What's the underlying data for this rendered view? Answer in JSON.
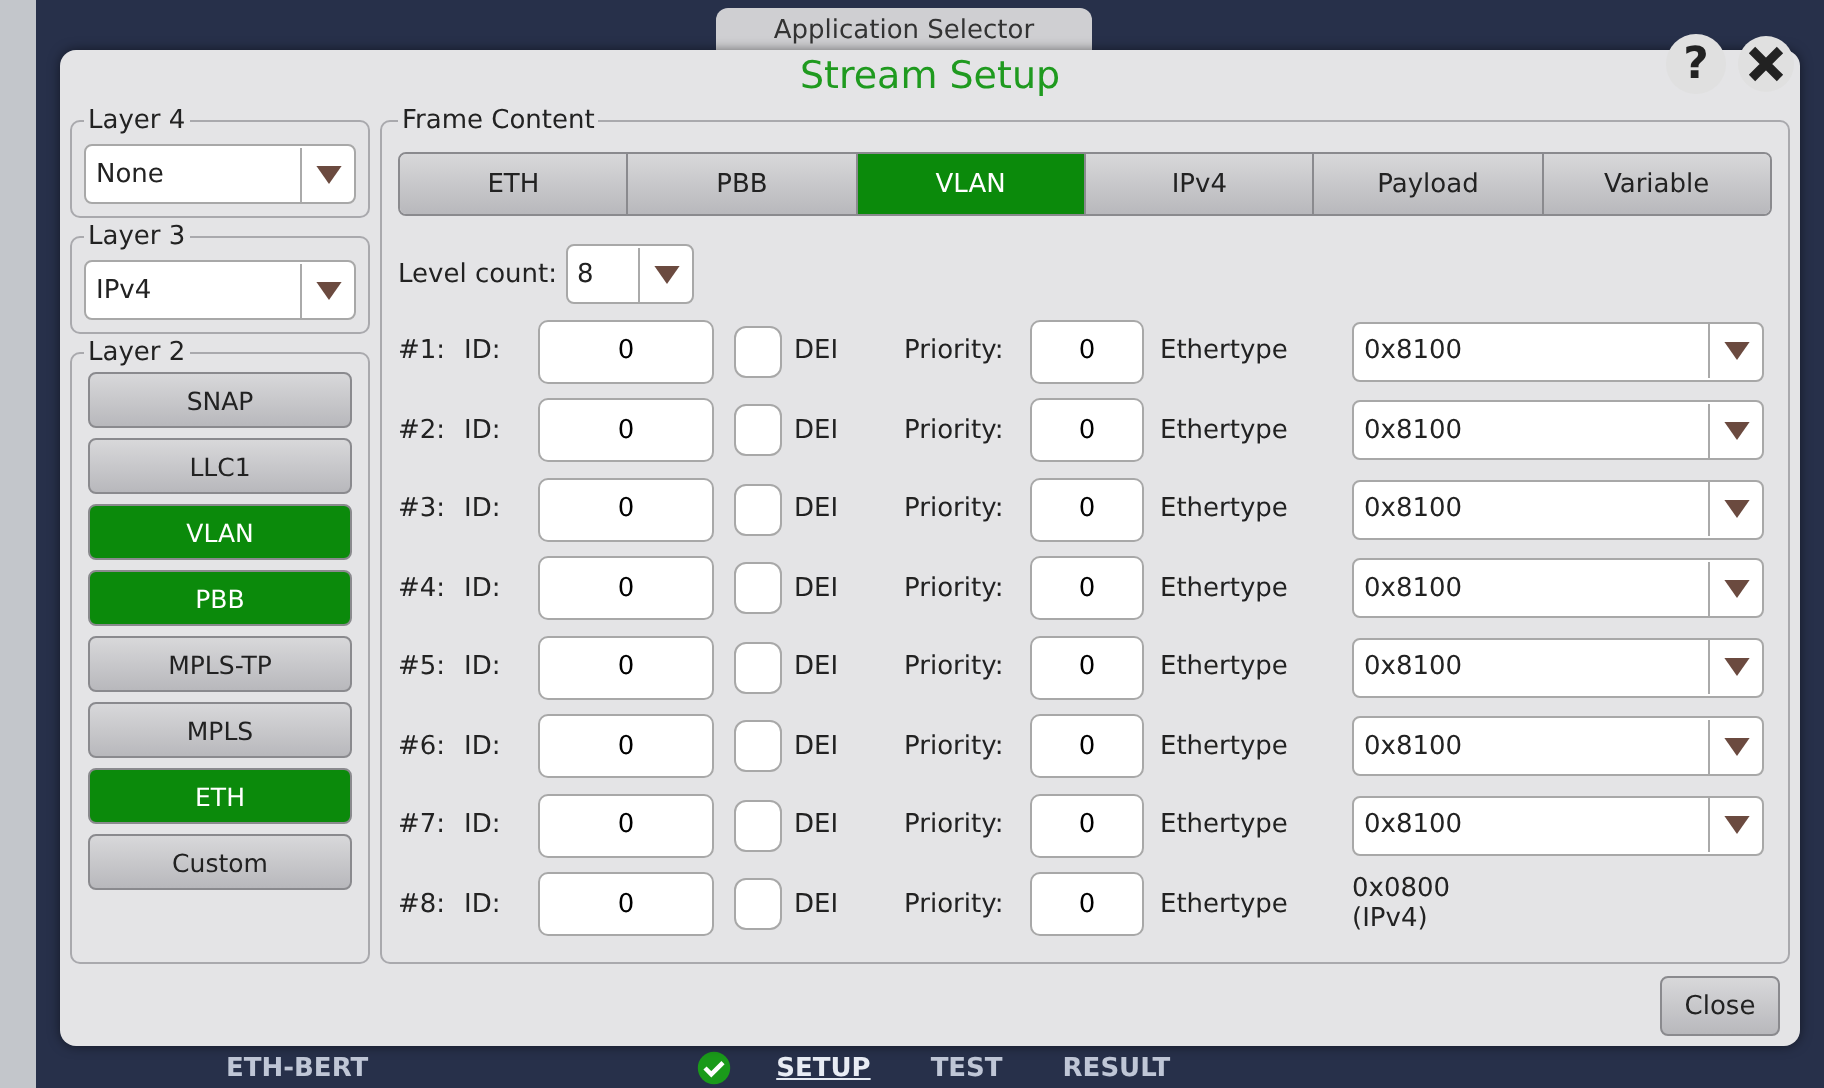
{
  "background_app": {
    "tab": "Application Selector",
    "app_name": "ETH-BERT",
    "nav": [
      {
        "label": "SETUP",
        "selected": true
      },
      {
        "label": "TEST",
        "selected": false
      },
      {
        "label": "RESULT",
        "selected": false
      }
    ]
  },
  "dialog": {
    "title": "Stream Setup",
    "help_button": "?"
  },
  "layer4": {
    "label": "Layer 4",
    "value": "None"
  },
  "layer3": {
    "label": "Layer 3",
    "value": "IPv4"
  },
  "layer2": {
    "label": "Layer 2",
    "options": [
      {
        "label": "SNAP",
        "selected": false
      },
      {
        "label": "LLC1",
        "selected": false
      },
      {
        "label": "VLAN",
        "selected": true
      },
      {
        "label": "PBB",
        "selected": true
      },
      {
        "label": "MPLS-TP",
        "selected": false
      },
      {
        "label": "MPLS",
        "selected": false
      },
      {
        "label": "ETH",
        "selected": true
      },
      {
        "label": "Custom",
        "selected": false
      }
    ]
  },
  "frame_content": {
    "label": "Frame Content",
    "tabs": [
      {
        "label": "ETH",
        "selected": false
      },
      {
        "label": "PBB",
        "selected": false
      },
      {
        "label": "VLAN",
        "selected": true
      },
      {
        "label": "IPv4",
        "selected": false
      },
      {
        "label": "Payload",
        "selected": false
      },
      {
        "label": "Variable",
        "selected": false
      }
    ],
    "level_count": {
      "label": "Level count:",
      "value": "8"
    },
    "levels": [
      {
        "index": "#1:",
        "id_label": "ID:",
        "id": "0",
        "dei_label": "DEI",
        "dei_checked": false,
        "priority_label": "Priority:",
        "priority": "0",
        "ethertype_label": "Ethertype",
        "kind": "select",
        "ethertype": [
          "0x8100"
        ]
      },
      {
        "index": "#2:",
        "id_label": "ID:",
        "id": "0",
        "dei_label": "DEI",
        "dei_checked": false,
        "priority_label": "Priority:",
        "priority": "0",
        "ethertype_label": "Ethertype",
        "kind": "select",
        "ethertype": [
          "0x8100"
        ]
      },
      {
        "index": "#3:",
        "id_label": "ID:",
        "id": "0",
        "dei_label": "DEI",
        "dei_checked": false,
        "priority_label": "Priority:",
        "priority": "0",
        "ethertype_label": "Ethertype",
        "kind": "select",
        "ethertype": [
          "0x8100"
        ]
      },
      {
        "index": "#4:",
        "id_label": "ID:",
        "id": "0",
        "dei_label": "DEI",
        "dei_checked": false,
        "priority_label": "Priority:",
        "priority": "0",
        "ethertype_label": "Ethertype",
        "kind": "select",
        "ethertype": [
          "0x8100"
        ]
      },
      {
        "index": "#5:",
        "id_label": "ID:",
        "id": "0",
        "dei_label": "DEI",
        "dei_checked": false,
        "priority_label": "Priority:",
        "priority": "0",
        "ethertype_label": "Ethertype",
        "kind": "select",
        "ethertype": [
          "0x8100"
        ]
      },
      {
        "index": "#6:",
        "id_label": "ID:",
        "id": "0",
        "dei_label": "DEI",
        "dei_checked": false,
        "priority_label": "Priority:",
        "priority": "0",
        "ethertype_label": "Ethertype",
        "kind": "select",
        "ethertype": [
          "0x8100"
        ]
      },
      {
        "index": "#7:",
        "id_label": "ID:",
        "id": "0",
        "dei_label": "DEI",
        "dei_checked": false,
        "priority_label": "Priority:",
        "priority": "0",
        "ethertype_label": "Ethertype",
        "kind": "select",
        "ethertype": [
          "0x8100"
        ]
      },
      {
        "index": "#8:",
        "id_label": "ID:",
        "id": "0",
        "dei_label": "DEI",
        "dei_checked": false,
        "priority_label": "Priority:",
        "priority": "0",
        "ethertype_label": "Ethertype",
        "kind": "text",
        "ethertype": [
          "0x0800",
          "(IPv4)"
        ]
      }
    ]
  },
  "close_button": "Close"
}
